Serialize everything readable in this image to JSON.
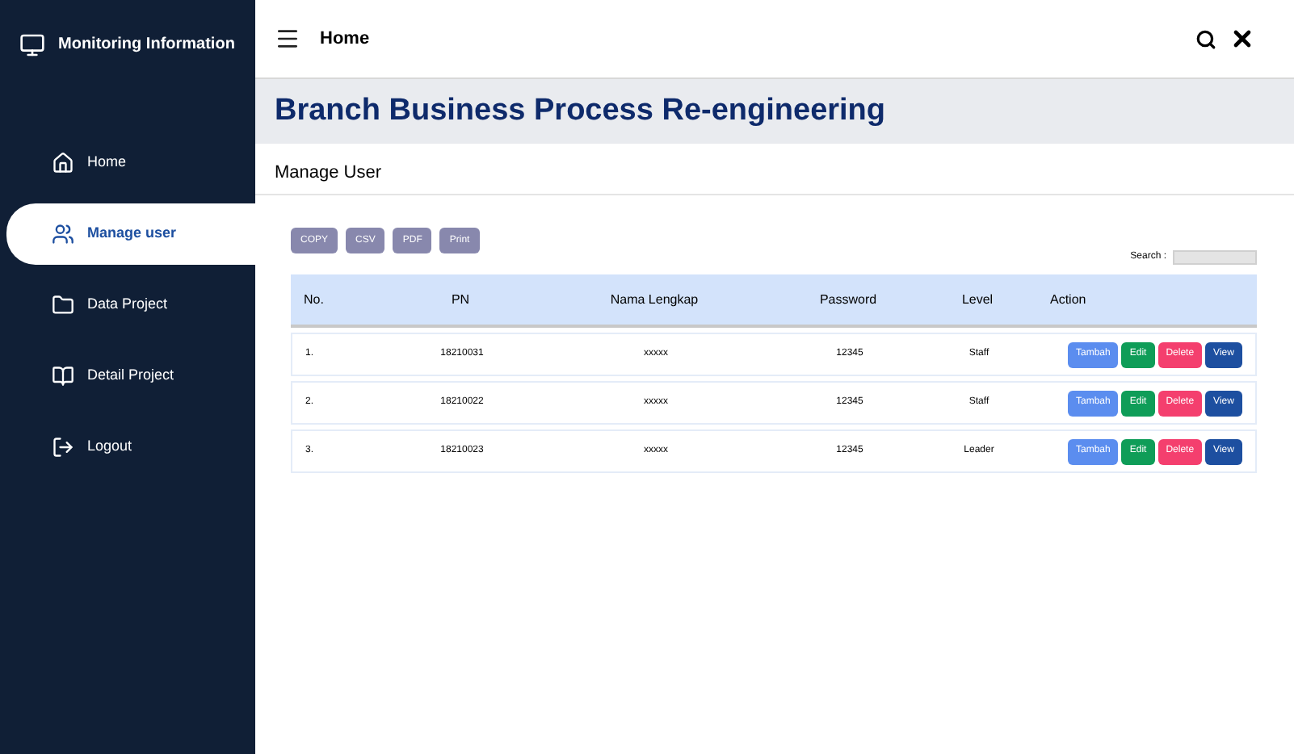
{
  "brand": {
    "title": "Monitoring Information"
  },
  "sidebar": {
    "items": [
      {
        "label": "Home",
        "kind": "home",
        "selected": false
      },
      {
        "label": "Manage user",
        "kind": "users",
        "selected": true
      },
      {
        "label": "Data Project",
        "kind": "folder",
        "selected": false
      },
      {
        "label": "Detail Project",
        "kind": "book",
        "selected": false
      },
      {
        "label": "Logout",
        "kind": "logout",
        "selected": false
      }
    ]
  },
  "header": {
    "title": "Home"
  },
  "page": {
    "title": "Branch Business Process Re-engineering",
    "section": "Manage User"
  },
  "export_buttons": [
    "COPY",
    "CSV",
    "PDF",
    "Print"
  ],
  "search": {
    "label": "Search :"
  },
  "table": {
    "columns": [
      "No.",
      "PN",
      "Nama Lengkap",
      "Password",
      "Level",
      "Action"
    ],
    "rows": [
      {
        "cells": [
          "1.",
          "18210031",
          "xxxxx",
          "12345",
          "Staff"
        ],
        "actions": [
          {
            "label": "Tambah",
            "kind": "add"
          },
          {
            "label": "Edit",
            "kind": "edit"
          },
          {
            "label": "Delete",
            "kind": "delete"
          },
          {
            "label": "View",
            "kind": "view"
          }
        ]
      },
      {
        "cells": [
          "2.",
          "18210022",
          "xxxxx",
          "12345",
          "Staff"
        ],
        "actions": [
          {
            "label": "Tambah",
            "kind": "add"
          },
          {
            "label": "Edit",
            "kind": "edit"
          },
          {
            "label": "Delete",
            "kind": "delete"
          },
          {
            "label": "View",
            "kind": "view"
          }
        ]
      },
      {
        "cells": [
          "3.",
          "18210023",
          "xxxxx",
          "12345",
          "Leader"
        ],
        "actions": [
          {
            "label": "Tambah",
            "kind": "add"
          },
          {
            "label": "Edit",
            "kind": "edit"
          },
          {
            "label": "Delete",
            "kind": "delete"
          },
          {
            "label": "View",
            "kind": "view"
          }
        ]
      }
    ]
  }
}
